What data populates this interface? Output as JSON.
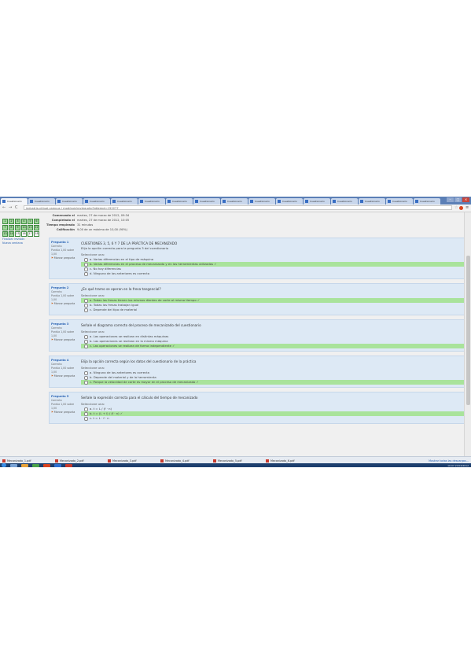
{
  "browser": {
    "tabs": [
      "Cuestionario",
      "Cuestionario",
      "Cuestionario",
      "Cuestionario",
      "Cuestionario",
      "Cuestionario",
      "Cuestionario",
      "Cuestionario",
      "Cuestionario",
      "Cuestionario",
      "Cuestionario",
      "Cuestionario",
      "Cuestionario",
      "Cuestionario",
      "Cuestionario",
      "Cuestionario"
    ],
    "url": "industria.virtual.campus / mod/quiz/review.php?attempt=152277",
    "nav_back": "←",
    "nav_forward": "→",
    "nav_reload": "C",
    "star": "☆",
    "menu": "≡"
  },
  "summary": [
    {
      "label": "Comenzado el",
      "value": "martes, 27 de marzo de 2012, 09:34"
    },
    {
      "label": "Completado el",
      "value": "martes, 27 de marzo de 2012, 10:05"
    },
    {
      "label": "Tiempo empleado",
      "value": "31 minutos"
    },
    {
      "label": "Calificación",
      "value": "9,00 de un máximo de 10,00 (90%)"
    }
  ],
  "quiz_nav": {
    "boxes": [
      "1",
      "2",
      "3",
      "4",
      "5",
      "6",
      "7",
      "8",
      "9",
      "10",
      "11",
      "12",
      "13",
      "14",
      "15",
      "16",
      "17",
      "18"
    ],
    "finish_link": "Finalizar revisión",
    "new_window_link": "Nueva ventana"
  },
  "questions": [
    {
      "number": "Pregunta 1",
      "status": "Correcta",
      "mark": "Puntúa 1,00 sobre 1,00",
      "flag": "Marcar pregunta",
      "text": "CUESTIONES 3, 5, 6 Y 7 DE LA PRÁCTICA DE MECANIZADO",
      "subtext": "Elija la opción correcta para la pregunta 3 del cuestionario",
      "answer_label": "Seleccione una:",
      "options": [
        {
          "text": "a. Varias diferencias en el tipo de máquina",
          "correct": false
        },
        {
          "text": "b. Varias diferencias en el proceso de mecanizado y en las herramientas utilizadas ✓",
          "correct": true
        },
        {
          "text": "c. No hay diferencias",
          "correct": false
        },
        {
          "text": "d. Ninguna de las anteriores es correcta",
          "correct": false
        }
      ]
    },
    {
      "number": "Pregunta 2",
      "status": "Correcta",
      "mark": "Puntúa 1,00 sobre 1,00",
      "flag": "Marcar pregunta",
      "text": "¿En qué tramo se operan en la fresa tangencial?",
      "subtext": "",
      "answer_label": "Seleccione una:",
      "options": [
        {
          "text": "a. Todas las fresas tienen los mismos dientes de corte al mismo tiempo ✓",
          "correct": true
        },
        {
          "text": "b. Todas las fresas trabajan igual",
          "correct": false
        },
        {
          "text": "c. Depende del tipo de material",
          "correct": false
        }
      ]
    },
    {
      "number": "Pregunta 3",
      "status": "Correcta",
      "mark": "Puntúa 1,00 sobre 1,00",
      "flag": "Marcar pregunta",
      "text": "Señale el diagrama correcto del proceso de mecanizado del cuestionario",
      "subtext": "",
      "answer_label": "Seleccione una:",
      "options": [
        {
          "text": "a. Las operaciones se realizan en distintas máquinas",
          "correct": false
        },
        {
          "text": "b. Las operaciones se realizan en la misma máquina",
          "correct": false
        },
        {
          "text": "c. Las operaciones se realizan de forma independiente ✓",
          "correct": true
        }
      ]
    },
    {
      "number": "Pregunta 4",
      "status": "Correcta",
      "mark": "Puntúa 1,00 sobre 1,00",
      "flag": "Marcar pregunta",
      "text": "Elija la opción correcta según los datos del cuestionario de la práctica",
      "subtext": "",
      "answer_label": "Seleccione una:",
      "options": [
        {
          "text": "a. Ninguna de las anteriores es correcta",
          "correct": false
        },
        {
          "text": "b. Depende del material y de la herramienta",
          "correct": false
        },
        {
          "text": "c. Porque la velocidad de corte es mayor en el proceso de mecanizado ✓",
          "correct": true
        }
      ]
    },
    {
      "number": "Pregunta 5",
      "status": "Correcta",
      "mark": "Puntúa 1,00 sobre 1,00",
      "flag": "Marcar pregunta",
      "text": "Señale la expresión correcta para el cálculo del tiempo de mecanizado",
      "subtext": "",
      "answer_label": "Seleccione una:",
      "options": [
        {
          "text": "a. t = L / (f · n)",
          "correct": false
        },
        {
          "text": "b. t = (L + l) / (f · n) ✓",
          "correct": true
        },
        {
          "text": "c. t = L · f · n",
          "correct": false
        }
      ]
    }
  ],
  "downloads": {
    "items": [
      "Mecanizado_1.pdf",
      "Mecanizado_2.pdf",
      "Mecanizado_3.pdf",
      "Mecanizado_4.pdf",
      "Mecanizado_5.pdf",
      "Mecanizado_6.pdf"
    ],
    "show_all": "Mostrar todas las descargas..."
  },
  "taskbar": {
    "clock": "10:07  27/03/2012"
  }
}
